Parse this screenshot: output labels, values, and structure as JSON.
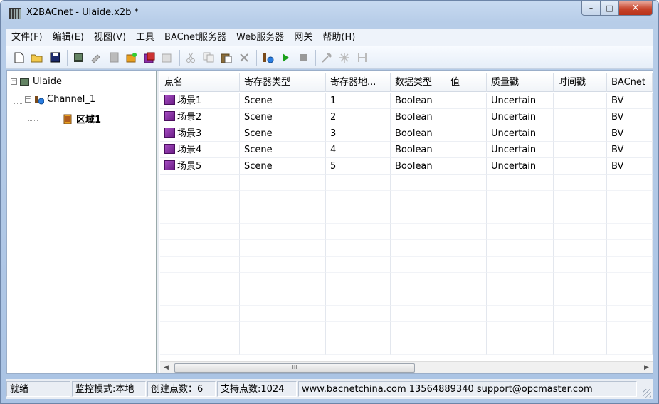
{
  "window": {
    "title": "X2BACnet - Ulaide.x2b *",
    "controls": {
      "minimize": "–",
      "maximize": "□",
      "close": "✕"
    }
  },
  "menu": [
    "文件(F)",
    "编辑(E)",
    "视图(V)",
    "工具",
    "BACnet服务器",
    "Web服务器",
    "网关",
    "帮助(H)"
  ],
  "toolbar": {
    "icons": [
      "new-file-icon",
      "open-folder-icon",
      "save-icon",
      "add-channel-icon",
      "add-device-icon",
      "add-region-icon",
      "add-tag-icon",
      "add-multiple-icon",
      "properties-icon",
      "cut-icon",
      "copy-icon",
      "paste-icon",
      "delete-icon",
      "gateway-icon",
      "run-icon",
      "stop-icon",
      "tools-icon",
      "settings-icon",
      "export-icon"
    ]
  },
  "tree": {
    "root": "Ulaide",
    "channel": "Channel_1",
    "region": "区域1"
  },
  "table": {
    "columns": [
      "点名",
      "寄存器类型",
      "寄存器地...",
      "数据类型",
      "值",
      "质量戳",
      "时间戳",
      "BACnet"
    ],
    "rows": [
      [
        "场景1",
        "Scene",
        "1",
        "Boolean",
        "",
        "Uncertain",
        "",
        "BV"
      ],
      [
        "场景2",
        "Scene",
        "2",
        "Boolean",
        "",
        "Uncertain",
        "",
        "BV"
      ],
      [
        "场景3",
        "Scene",
        "3",
        "Boolean",
        "",
        "Uncertain",
        "",
        "BV"
      ],
      [
        "场景4",
        "Scene",
        "4",
        "Boolean",
        "",
        "Uncertain",
        "",
        "BV"
      ],
      [
        "场景5",
        "Scene",
        "5",
        "Boolean",
        "",
        "Uncertain",
        "",
        "BV"
      ]
    ]
  },
  "scrollbar": {
    "thumb_grip": "III"
  },
  "status": {
    "ready": "就绪",
    "mode": "监控模式:本地",
    "created": "创建点数：6",
    "supported": "支持点数:1024",
    "contact": "www.bacnetchina.com 13564889340 support@opcmaster.com"
  },
  "colors": {
    "point_icon": "#8a2fa6",
    "run_green": "#1aa01a",
    "title_bg": "#c8daf1"
  }
}
